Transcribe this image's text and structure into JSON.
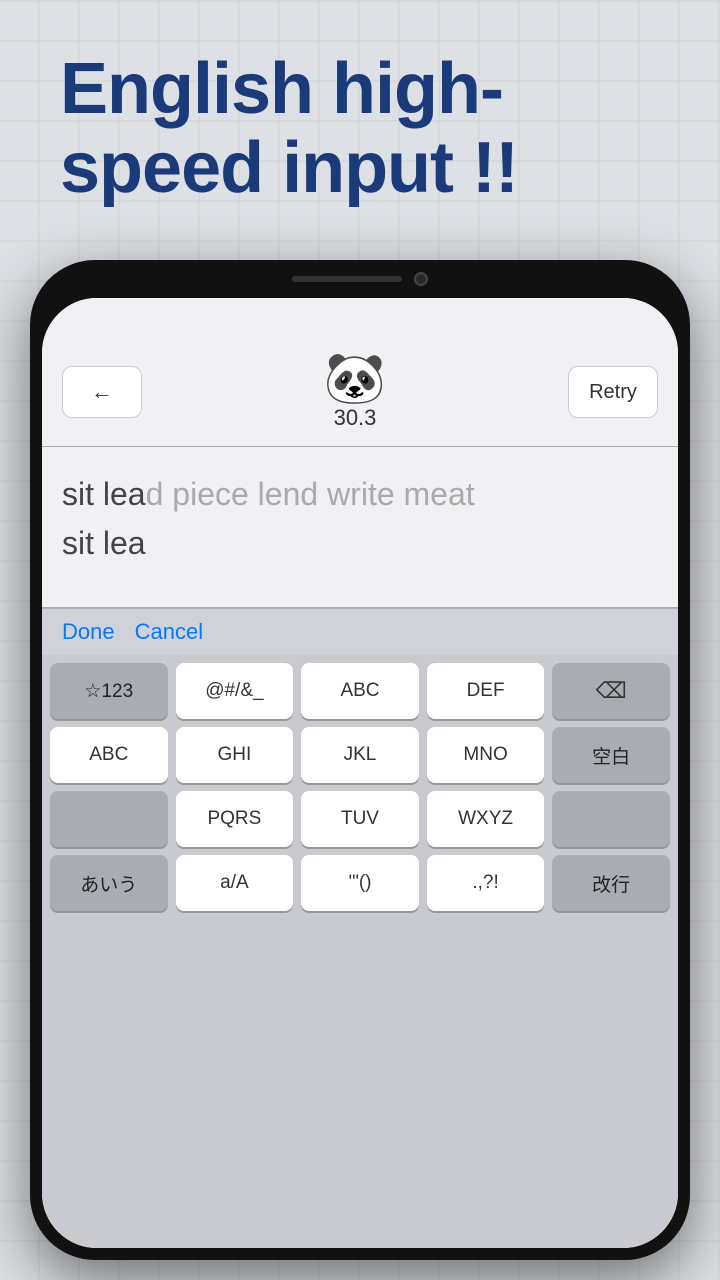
{
  "background": {
    "color": "#dde0e5"
  },
  "headline": {
    "line1": "English high-",
    "line2": "speed input !!",
    "color": "#1a3a7a"
  },
  "phone": {
    "topBar": {
      "backButtonLabel": "←",
      "score": "30.3",
      "retryLabel": "Retry"
    },
    "textArea": {
      "targetLine": "sit lead piece lend write meat",
      "targetTyped": "sit lea",
      "targetRemaining": "d piece lend write meat",
      "typedLine": "sit lea"
    },
    "keyboard": {
      "toolbarDone": "Done",
      "toolbarCancel": "Cancel",
      "rows": [
        [
          "☆123",
          "@#/&_",
          "ABC",
          "DEF",
          "⌫"
        ],
        [
          "ABC",
          "GHI",
          "JKL",
          "MNO",
          "空白"
        ],
        [
          "",
          "PQRS",
          "TUV",
          "WXYZ",
          ""
        ],
        [
          "あいう",
          "a/A",
          "'\"()",
          ".,?!",
          "改行"
        ]
      ]
    }
  }
}
